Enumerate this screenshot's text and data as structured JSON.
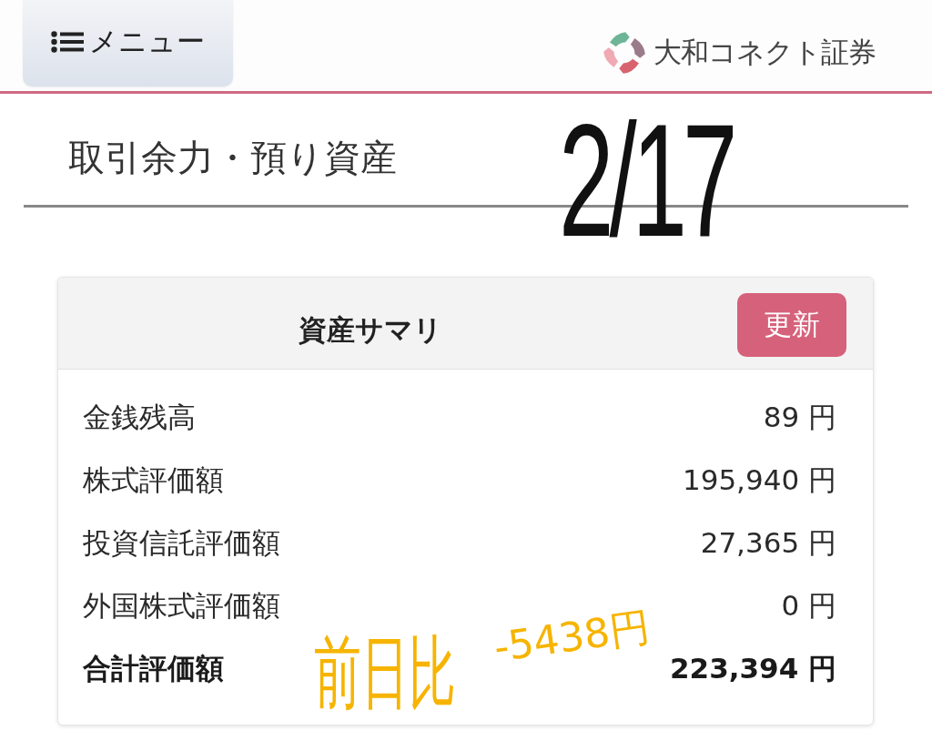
{
  "header": {
    "menu_button": "メニュー",
    "brand": "大和コネクト証券"
  },
  "page_title": "取引余力・預り資産",
  "summary": {
    "title": "資産サマリ",
    "refresh_button": "更新",
    "rows": [
      {
        "label": "金銭残高",
        "value": "89 円",
        "total": false
      },
      {
        "label": "株式評価額",
        "value": "195,940 円",
        "total": false
      },
      {
        "label": "投資信託評価額",
        "value": "27,365 円",
        "total": false
      },
      {
        "label": "外国株式評価額",
        "value": "0 円",
        "total": false
      },
      {
        "label": "合計評価額",
        "value": "223,394 円",
        "total": true
      }
    ]
  },
  "annotations": [
    {
      "kind": "date",
      "text": "2/17"
    },
    {
      "kind": "change-label",
      "text": "前日比"
    },
    {
      "kind": "change-amount",
      "text": "-5438円"
    }
  ]
}
